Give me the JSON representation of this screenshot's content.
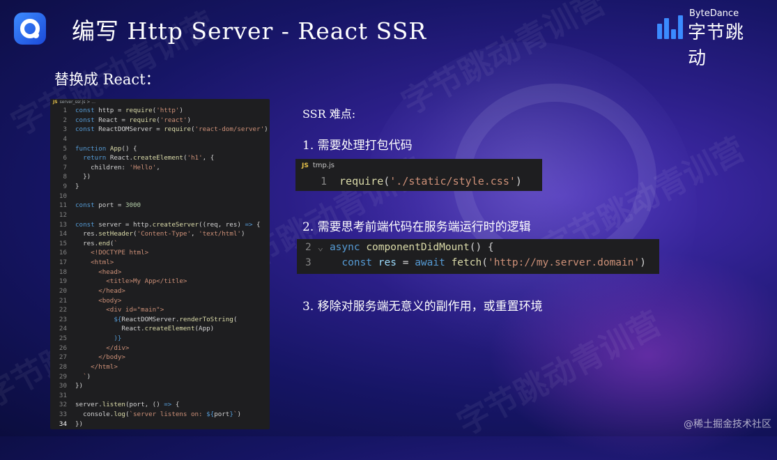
{
  "slide": {
    "title": "编写 Http Server -  React SSR",
    "subtitle": "替换成 React：",
    "brand_en": "ByteDance",
    "brand_cn": "字节跳动",
    "brand_color": "#3b8bff",
    "watermark": "字节跳动青训营",
    "credit": "@稀土掘金技术社区"
  },
  "code_panel": {
    "tab_icon": "JS",
    "tab_label": "server_ssr.js > ...",
    "lines": [
      {
        "n": "1",
        "html": "<span class='tok-k'>const</span> http = <span class='tok-f'>require</span>(<span class='tok-s'>'http'</span>)"
      },
      {
        "n": "2",
        "html": "<span class='tok-k'>const</span> React = <span class='tok-f'>require</span>(<span class='tok-s'>'react'</span>)"
      },
      {
        "n": "3",
        "html": "<span class='tok-k'>const</span> ReactDOMServer = <span class='tok-f'>require</span>(<span class='tok-s'>'react-dom/server'</span>)"
      },
      {
        "n": "4",
        "html": ""
      },
      {
        "n": "5",
        "html": "<span class='tok-k'>function</span> <span class='tok-f'>App</span>() {"
      },
      {
        "n": "6",
        "html": "  <span class='tok-k'>return</span> React.<span class='tok-f'>createElement</span>(<span class='tok-s'>'h1'</span>, {"
      },
      {
        "n": "7",
        "html": "    children: <span class='tok-s'>'Hello'</span>,"
      },
      {
        "n": "8",
        "html": "  })"
      },
      {
        "n": "9",
        "html": "}"
      },
      {
        "n": "10",
        "html": ""
      },
      {
        "n": "11",
        "html": "<span class='tok-k'>const</span> port = <span class='tok-n'>3000</span>"
      },
      {
        "n": "12",
        "html": ""
      },
      {
        "n": "13",
        "html": "<span class='tok-k'>const</span> server = http.<span class='tok-f'>createServer</span>((req, res) <span class='tok-k'>=&gt;</span> {"
      },
      {
        "n": "14",
        "html": "  res.<span class='tok-f'>setHeader</span>(<span class='tok-s'>'Content-Type'</span>, <span class='tok-s'>'text/html'</span>)"
      },
      {
        "n": "15",
        "html": "  res.<span class='tok-f'>end</span>(<span class='tok-s'>`</span>"
      },
      {
        "n": "16",
        "html": "<span class='tok-s'>    &lt;!DOCTYPE html&gt;</span>"
      },
      {
        "n": "17",
        "html": "<span class='tok-s'>    &lt;html&gt;</span>"
      },
      {
        "n": "18",
        "html": "<span class='tok-s'>      &lt;head&gt;</span>"
      },
      {
        "n": "19",
        "html": "<span class='tok-s'>        &lt;title&gt;My App&lt;/title&gt;</span>"
      },
      {
        "n": "20",
        "html": "<span class='tok-s'>      &lt;/head&gt;</span>"
      },
      {
        "n": "21",
        "html": "<span class='tok-s'>      &lt;body&gt;</span>"
      },
      {
        "n": "22",
        "html": "<span class='tok-s'>        &lt;div id=\"main\"&gt;</span>"
      },
      {
        "n": "23",
        "html": "          <span class='tok-k'>${</span>ReactDOMServer.<span class='tok-f'>renderToString</span>("
      },
      {
        "n": "24",
        "html": "            React.<span class='tok-f'>createElement</span>(App)"
      },
      {
        "n": "25",
        "html": "          <span class='tok-k'>)}</span>"
      },
      {
        "n": "26",
        "html": "<span class='tok-s'>        &lt;/div&gt;</span>"
      },
      {
        "n": "27",
        "html": "<span class='tok-s'>      &lt;/body&gt;</span>"
      },
      {
        "n": "28",
        "html": "<span class='tok-s'>    &lt;/html&gt;</span>"
      },
      {
        "n": "29",
        "html": "<span class='tok-s'>  `</span>)"
      },
      {
        "n": "30",
        "html": "})"
      },
      {
        "n": "31",
        "html": ""
      },
      {
        "n": "32",
        "html": "server.<span class='tok-f'>listen</span>(port, () <span class='tok-k'>=&gt;</span> {"
      },
      {
        "n": "33",
        "html": "  console.<span class='tok-f'>log</span>(<span class='tok-s'>`server listens on: </span><span class='tok-k'>${</span>port<span class='tok-k'>}</span><span class='tok-s'>`</span>)"
      },
      {
        "n": "34",
        "html": "})"
      }
    ]
  },
  "ssr": {
    "heading": "SSR 难点:",
    "item1": "1. 需要处理打包代码",
    "item2": "2. 需要思考前端代码在服务端运行时的逻辑",
    "item3": "3. 移除对服务端无意义的副作用，或重置环境"
  },
  "snippet1": {
    "tab_icon": "JS",
    "tab_label": "tmp.js",
    "line_num": "1",
    "code_fn": "require",
    "code_arg": "'./static/style.css'",
    "code_open": "(",
    "code_close": ")"
  },
  "snippet2": {
    "row1_num": "2",
    "row1_kw": "async",
    "row1_fn": "componentDidMount",
    "row1_rest": "() {",
    "row2_num": "3",
    "row2_kw1": "const",
    "row2_var": "res",
    "row2_eq": "=",
    "row2_kw2": "await",
    "row2_fn": "fetch",
    "row2_arg": "'http://my.server.domain'",
    "row2_close": ")"
  }
}
